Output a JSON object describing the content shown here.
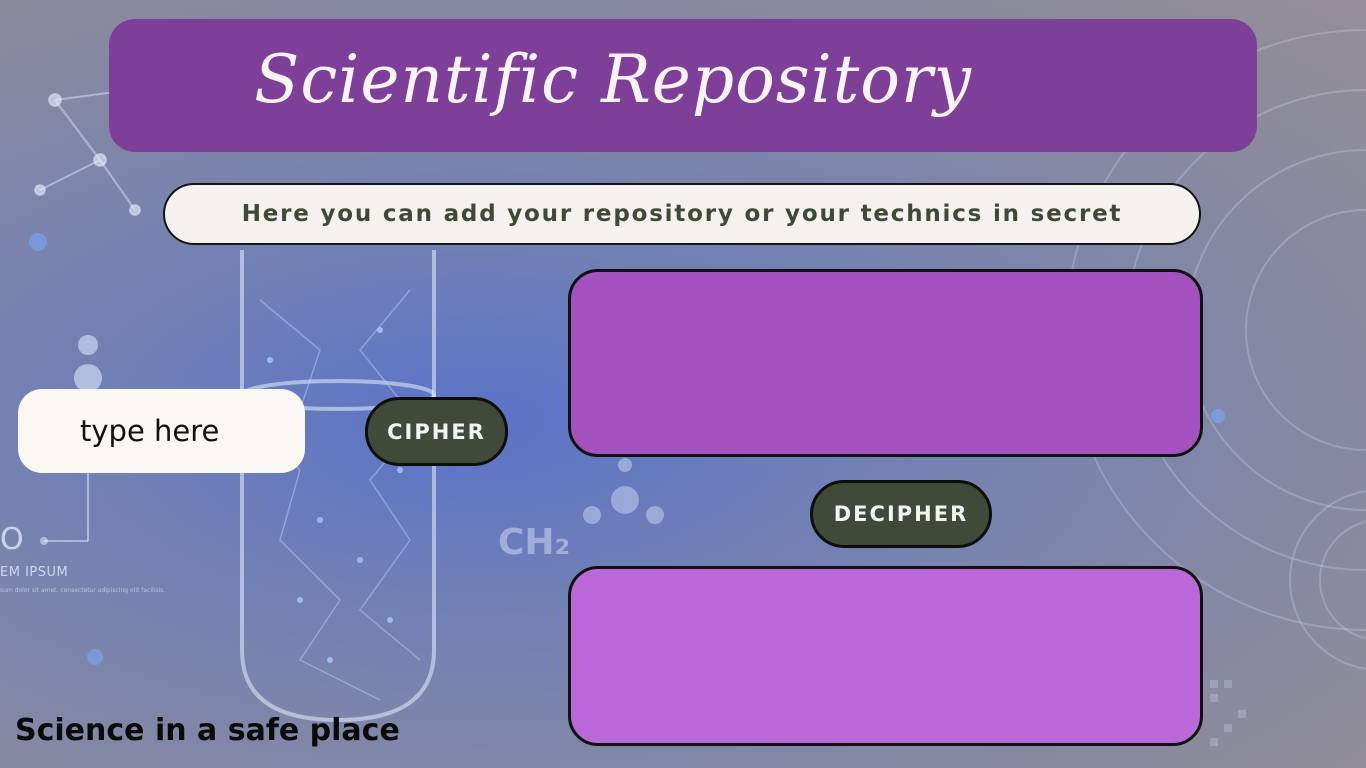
{
  "app": {
    "title": "Scientific Repository",
    "subtitle": "Here you can add your repository or your technics in secret",
    "footer": "Science in a safe place"
  },
  "input": {
    "placeholder": "type here",
    "value": ""
  },
  "buttons": {
    "cipher_label": "CIPHER",
    "decipher_label": "DECIPHER"
  },
  "outputs": {
    "cipher_result": "",
    "decipher_result": ""
  },
  "background": {
    "lorem_label": "EM IPSUM",
    "lorem_small": "sum dolor sit amet, consectetur adipiscing elit facilisis.",
    "chem_label": "CH₂",
    "ring_label": "O"
  },
  "colors": {
    "title_banner": "#7e3f98",
    "button_bg": "#3f4a38",
    "cipher_panel": "#a452c0",
    "decipher_panel": "#bb69d8",
    "subtitle_text": "#3f4a36"
  }
}
